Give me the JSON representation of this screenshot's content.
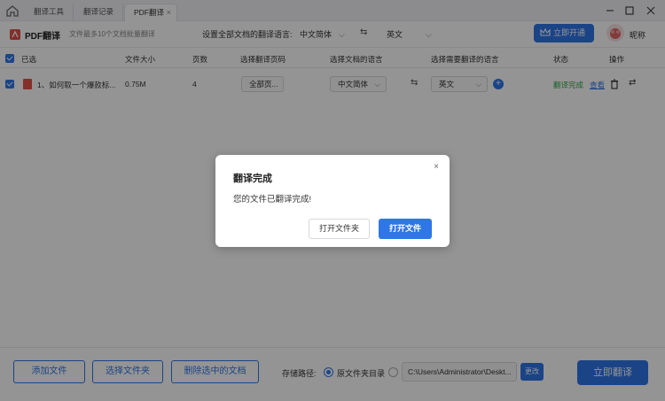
{
  "tabs": [
    {
      "label": "翻译工具"
    },
    {
      "label": "翻译记录"
    },
    {
      "label": "PDF翻译"
    }
  ],
  "toolbar": {
    "app_name": "PDF翻译",
    "hint": "文件最多10个文档批量翻译",
    "set_lang_label": "设置全部文档的翻译语言:",
    "source_lang": "中文简体",
    "target_lang": "英文",
    "vip_button": "立即开通",
    "nickname": "昵称"
  },
  "table": {
    "headers": {
      "selected": "已选",
      "size": "文件大小",
      "pages": "页数",
      "page_range": "选择翻译页码",
      "doc_lang": "选择文档的语言",
      "target_lang": "选择需要翻译的语言",
      "status": "状态",
      "actions": "操作"
    },
    "rows": [
      {
        "index_name": "1、如何取一个爆款标...",
        "size": "0.75M",
        "pages": "4",
        "page_range": "全部页...",
        "doc_lang": "中文简体",
        "target_lang": "英文",
        "status": "翻译完成",
        "view": "查看"
      }
    ]
  },
  "footer": {
    "add_file": "添加文件",
    "select_folder": "选择文件夹",
    "delete_selected": "删除选中的文档",
    "path_label": "存储路径:",
    "radio_original": "原文件夹目录",
    "path_value": "C:\\Users\\Administrator\\Deskt...",
    "change": "更改",
    "translate_now": "立即翻译"
  },
  "dialog": {
    "title": "翻译完成",
    "message": "您的文件已翻译完成!",
    "open_folder": "打开文件夹",
    "open_file": "打开文件",
    "close": "×"
  },
  "colors": {
    "accent": "#2f76e8",
    "success": "#2aa84a",
    "pdf_red": "#e35149"
  }
}
